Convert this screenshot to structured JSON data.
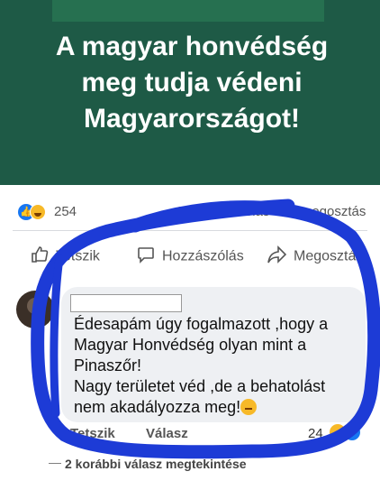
{
  "banner": {
    "headline": "A magyar honvédség\nmeg tudja védeni\nMagyarországot!"
  },
  "post_stats": {
    "reaction_count": "254",
    "comments_shares": "93 hozzászólás • 27 megosztás"
  },
  "post_actions": {
    "like_label": "Tetszik",
    "comment_label": "Hozzászólás",
    "share_label": "Megosztás"
  },
  "comment": {
    "text": "Édesapám úgy fogalmazott ,hogy a\nMagyar Honvédség olyan mint a\nPinaszőr!\nNagy területet véd ,de a behatolást\nnem akadályozza meg!",
    "like_label": "Tetszik",
    "reply_label": "Válasz",
    "reaction_count": "24"
  },
  "replies": {
    "view_label": "2 korábbi válasz megtekintése"
  },
  "colors": {
    "banner_bg": "#1e5a46",
    "facebook_blue": "#1877f2",
    "scribble_blue": "#1d3bd6"
  }
}
